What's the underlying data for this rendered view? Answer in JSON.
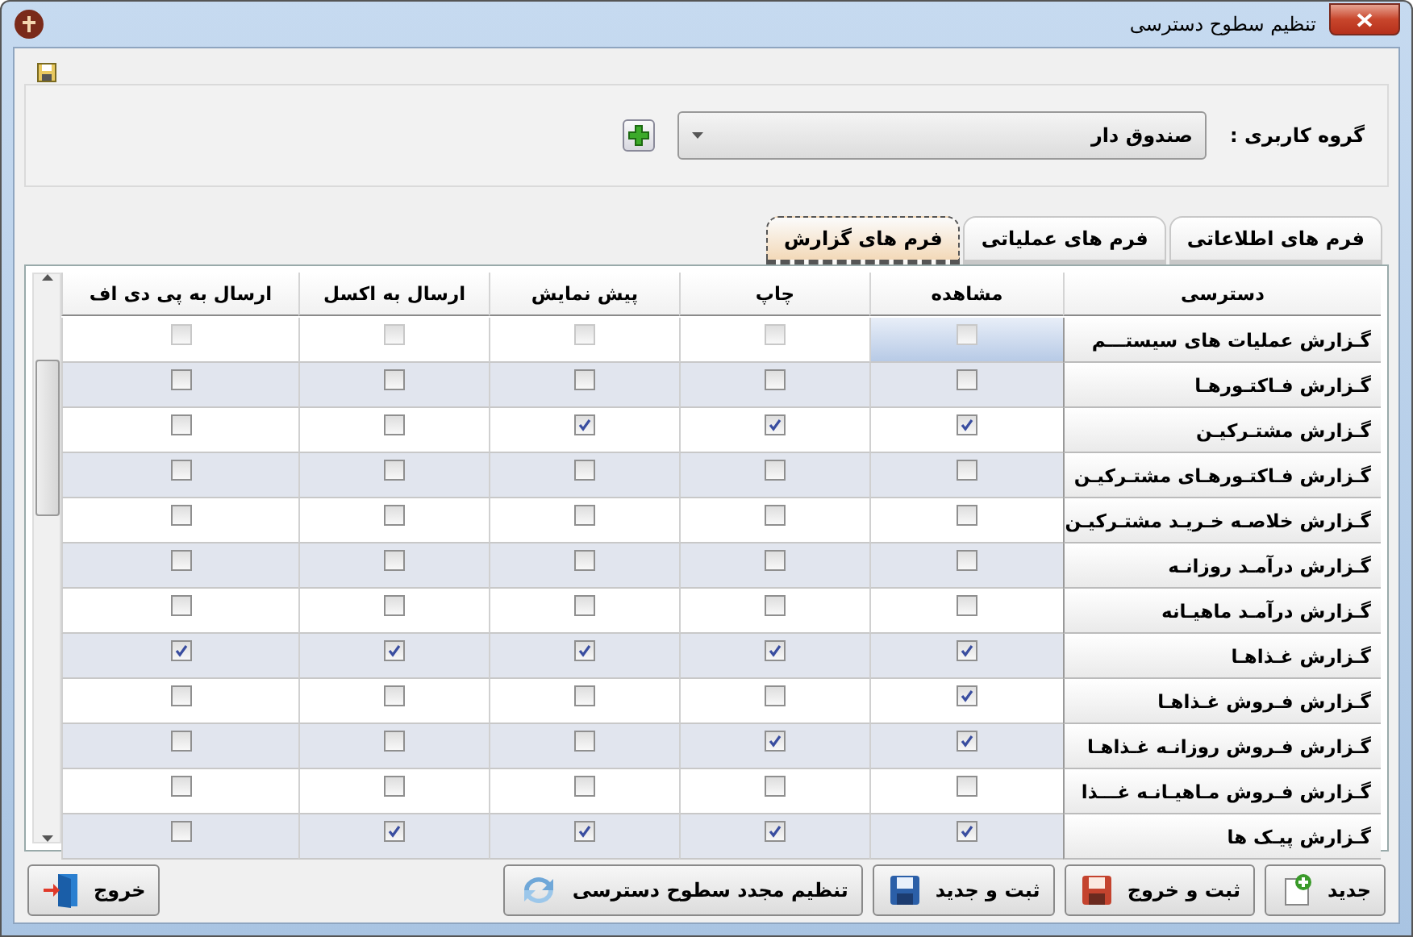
{
  "window": {
    "title": "تنظیم سطوح دسترسی"
  },
  "user_group": {
    "label": "گروه کاربری :",
    "value": "صندوق دار"
  },
  "tabs": [
    {
      "label": "فرم های اطلاعاتی",
      "selected": false
    },
    {
      "label": "فرم های عملیاتی",
      "selected": false
    },
    {
      "label": "فرم های گزارش",
      "selected": true
    }
  ],
  "table": {
    "columns": [
      "دسترسی",
      "مشاهده",
      "چاپ",
      "پیش نمایش",
      "ارسال به اکسل",
      "ارسال به پی دی اف"
    ],
    "rows": [
      {
        "name": "گـزارش عملیات های سیستـــم",
        "selected": true,
        "checks": [
          false,
          false,
          false,
          false,
          false
        ]
      },
      {
        "name": "گـزارش فـاکتـورهـا",
        "selected": false,
        "checks": [
          false,
          false,
          false,
          false,
          false
        ]
      },
      {
        "name": "گـزارش مشتـرکیـن",
        "selected": false,
        "checks": [
          true,
          true,
          true,
          false,
          false
        ]
      },
      {
        "name": "گـزارش فـاکتـورهـای مشتـرکیـن",
        "selected": false,
        "checks": [
          false,
          false,
          false,
          false,
          false
        ]
      },
      {
        "name": "گـزارش خلاصـه خـریـد مشتـرکیـن",
        "selected": false,
        "checks": [
          false,
          false,
          false,
          false,
          false
        ]
      },
      {
        "name": "گـزارش درآمـد روزانـه",
        "selected": false,
        "checks": [
          false,
          false,
          false,
          false,
          false
        ]
      },
      {
        "name": "گـزارش درآمـد ماهیـانه",
        "selected": false,
        "checks": [
          false,
          false,
          false,
          false,
          false
        ]
      },
      {
        "name": "گـزارش غـذاهـا",
        "selected": false,
        "checks": [
          true,
          true,
          true,
          true,
          true
        ]
      },
      {
        "name": "گـزارش فـروش غـذاهـا",
        "selected": false,
        "checks": [
          true,
          false,
          false,
          false,
          false
        ]
      },
      {
        "name": "گـزارش فـروش روزانـه غـذاهـا",
        "selected": false,
        "checks": [
          true,
          true,
          false,
          false,
          false
        ]
      },
      {
        "name": "گـزارش فـروش مـاهیـانـه غـــذا",
        "selected": false,
        "checks": [
          false,
          false,
          false,
          false,
          false
        ]
      },
      {
        "name": "گـزارش پیـک ها",
        "selected": false,
        "checks": [
          true,
          true,
          true,
          true,
          false
        ]
      }
    ]
  },
  "buttons": [
    {
      "kind": "new",
      "label": "جدید"
    },
    {
      "kind": "save_exit",
      "label": "ثبت و خروج"
    },
    {
      "kind": "save_new",
      "label": "ثبت و جدید"
    },
    {
      "kind": "reset",
      "label": "تنظیم مجدد سطوح دسترسی"
    },
    {
      "kind": "exit",
      "label": "خروج"
    }
  ]
}
